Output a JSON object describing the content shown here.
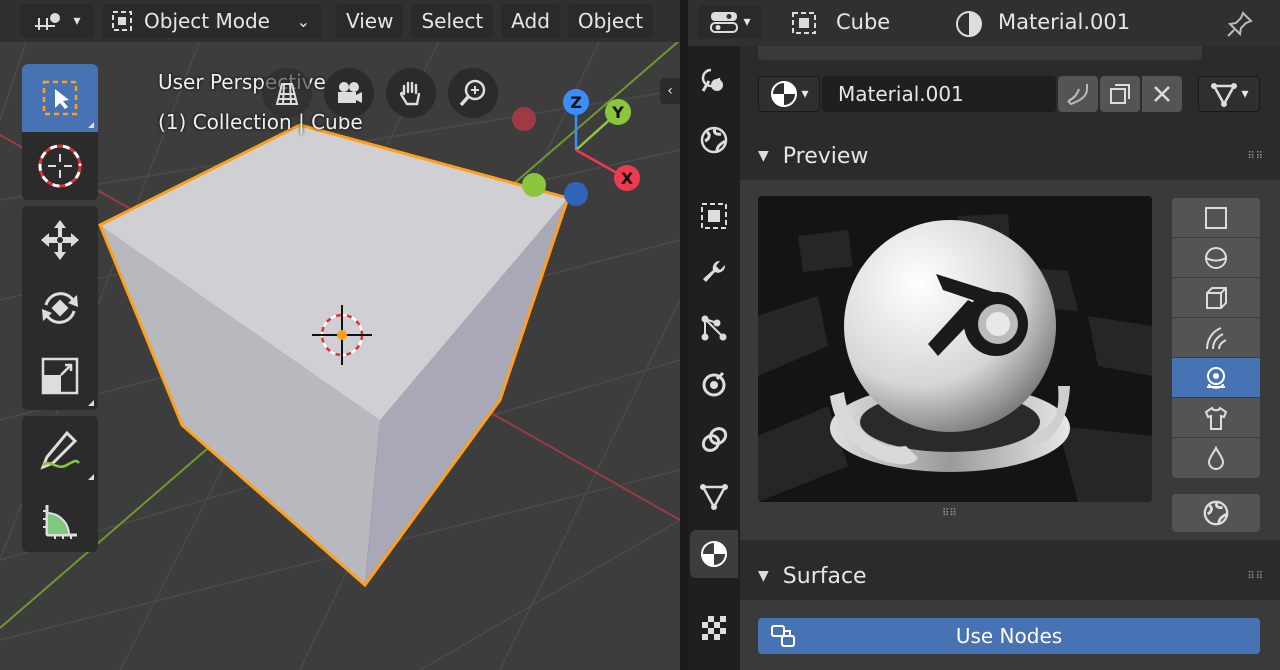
{
  "viewport": {
    "header": {
      "mode_label": "Object Mode",
      "menus": [
        "View",
        "Select",
        "Add",
        "Object"
      ]
    },
    "overlay": {
      "line1": "User Perspective",
      "line2": "(1) Collection | Cube"
    },
    "gizmo": {
      "x": "X",
      "y": "Y",
      "z": "Z"
    }
  },
  "properties": {
    "header": {
      "object_name": "Cube",
      "material_name": "Material.001"
    },
    "material_slot": {
      "name": "Material.001"
    },
    "panels": {
      "preview": "Preview",
      "surface": "Surface"
    },
    "use_nodes_label": "Use Nodes"
  },
  "colors": {
    "accent": "#4772b3",
    "selection_outline": "#ff9f1a",
    "axis_x": "#ee3a4e",
    "axis_y": "#8cc63f",
    "axis_z": "#3b8dfd"
  }
}
